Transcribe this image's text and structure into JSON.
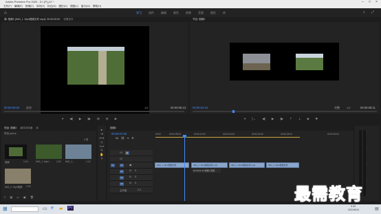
{
  "window": {
    "title": "Adobe Premiere Pro 2020 - D:\\ (P)ر\\Ĳ * "
  },
  "menu": {
    "items": [
      "文件(F)",
      "编辑(E)",
      "剪辑(C)",
      "序列(S)",
      "标记(M)",
      "图形(G)",
      "视图(V)",
      "窗口(W)",
      "帮助(H)"
    ]
  },
  "workspaces": {
    "items": [
      "学习",
      "组件",
      "编辑",
      "颜色",
      "效果",
      "音频",
      "图形",
      "库"
    ],
    "active": 0
  },
  "source_monitor": {
    "tabs": [
      "源: 视频2 (IMG_1 .Mp4视频文件.mp4): 00:00:00:00",
      "效果控件"
    ],
    "timecode_left": "00:00:00:00",
    "fit": "适合",
    "ratio": "1/2",
    "timecode_right": "00:00:06:13"
  },
  "program_monitor": {
    "tab": "节目: 视频2",
    "timecode_left": "00:00:02:16",
    "fit": "完整",
    "ratio": "1/2",
    "timecode_right": "00:00:09:11"
  },
  "project": {
    "tabs": [
      "项目: 视频2",
      "媒体浏览器",
      "库"
    ],
    "search_placeholder": "项目.prproj",
    "items_count": "4 项",
    "items": [
      {
        "name": "视频",
        "duration": "1:10"
      },
      {
        "name": "IMG_1 .Mp4 ...",
        "duration": "2:02"
      },
      {
        "name": "IMG_1...",
        "duration": "1:12"
      },
      {
        "name": "IMG_2 .Mp4视频",
        "duration": "2:02"
      }
    ]
  },
  "timeline": {
    "tab": "视频2",
    "timecode": "00:00:07:00",
    "ruler": [
      "00:00",
      "00:00:05:00",
      "00:00:10:00",
      "00:00:15:00",
      "00:00:20:00",
      "00:00:25:00",
      "00:00:30:00"
    ],
    "tracks": [
      "V3",
      "V2",
      "V1",
      "A1",
      "A2",
      "A3"
    ],
    "master": "主声道",
    "master_val": "0.0",
    "clips_v1": [
      "IMG_1 .Mp4视频文件",
      "IMG_1 .Mp4视频文件.mp4",
      "IMG_1 .Mp4视频文件.mp4",
      "IMG_1 .Mp4视频文件"
    ],
    "tooltip": "00:00:02:16 视频2 音频"
  },
  "watermark": {
    "text": "最需教育"
  },
  "taskbar": {
    "time": "9:33",
    "date": "2021/6/24"
  },
  "colors": {
    "accent": "#3f8cff",
    "clip": "#8aa5c9",
    "playhead": "#3f8cff"
  }
}
